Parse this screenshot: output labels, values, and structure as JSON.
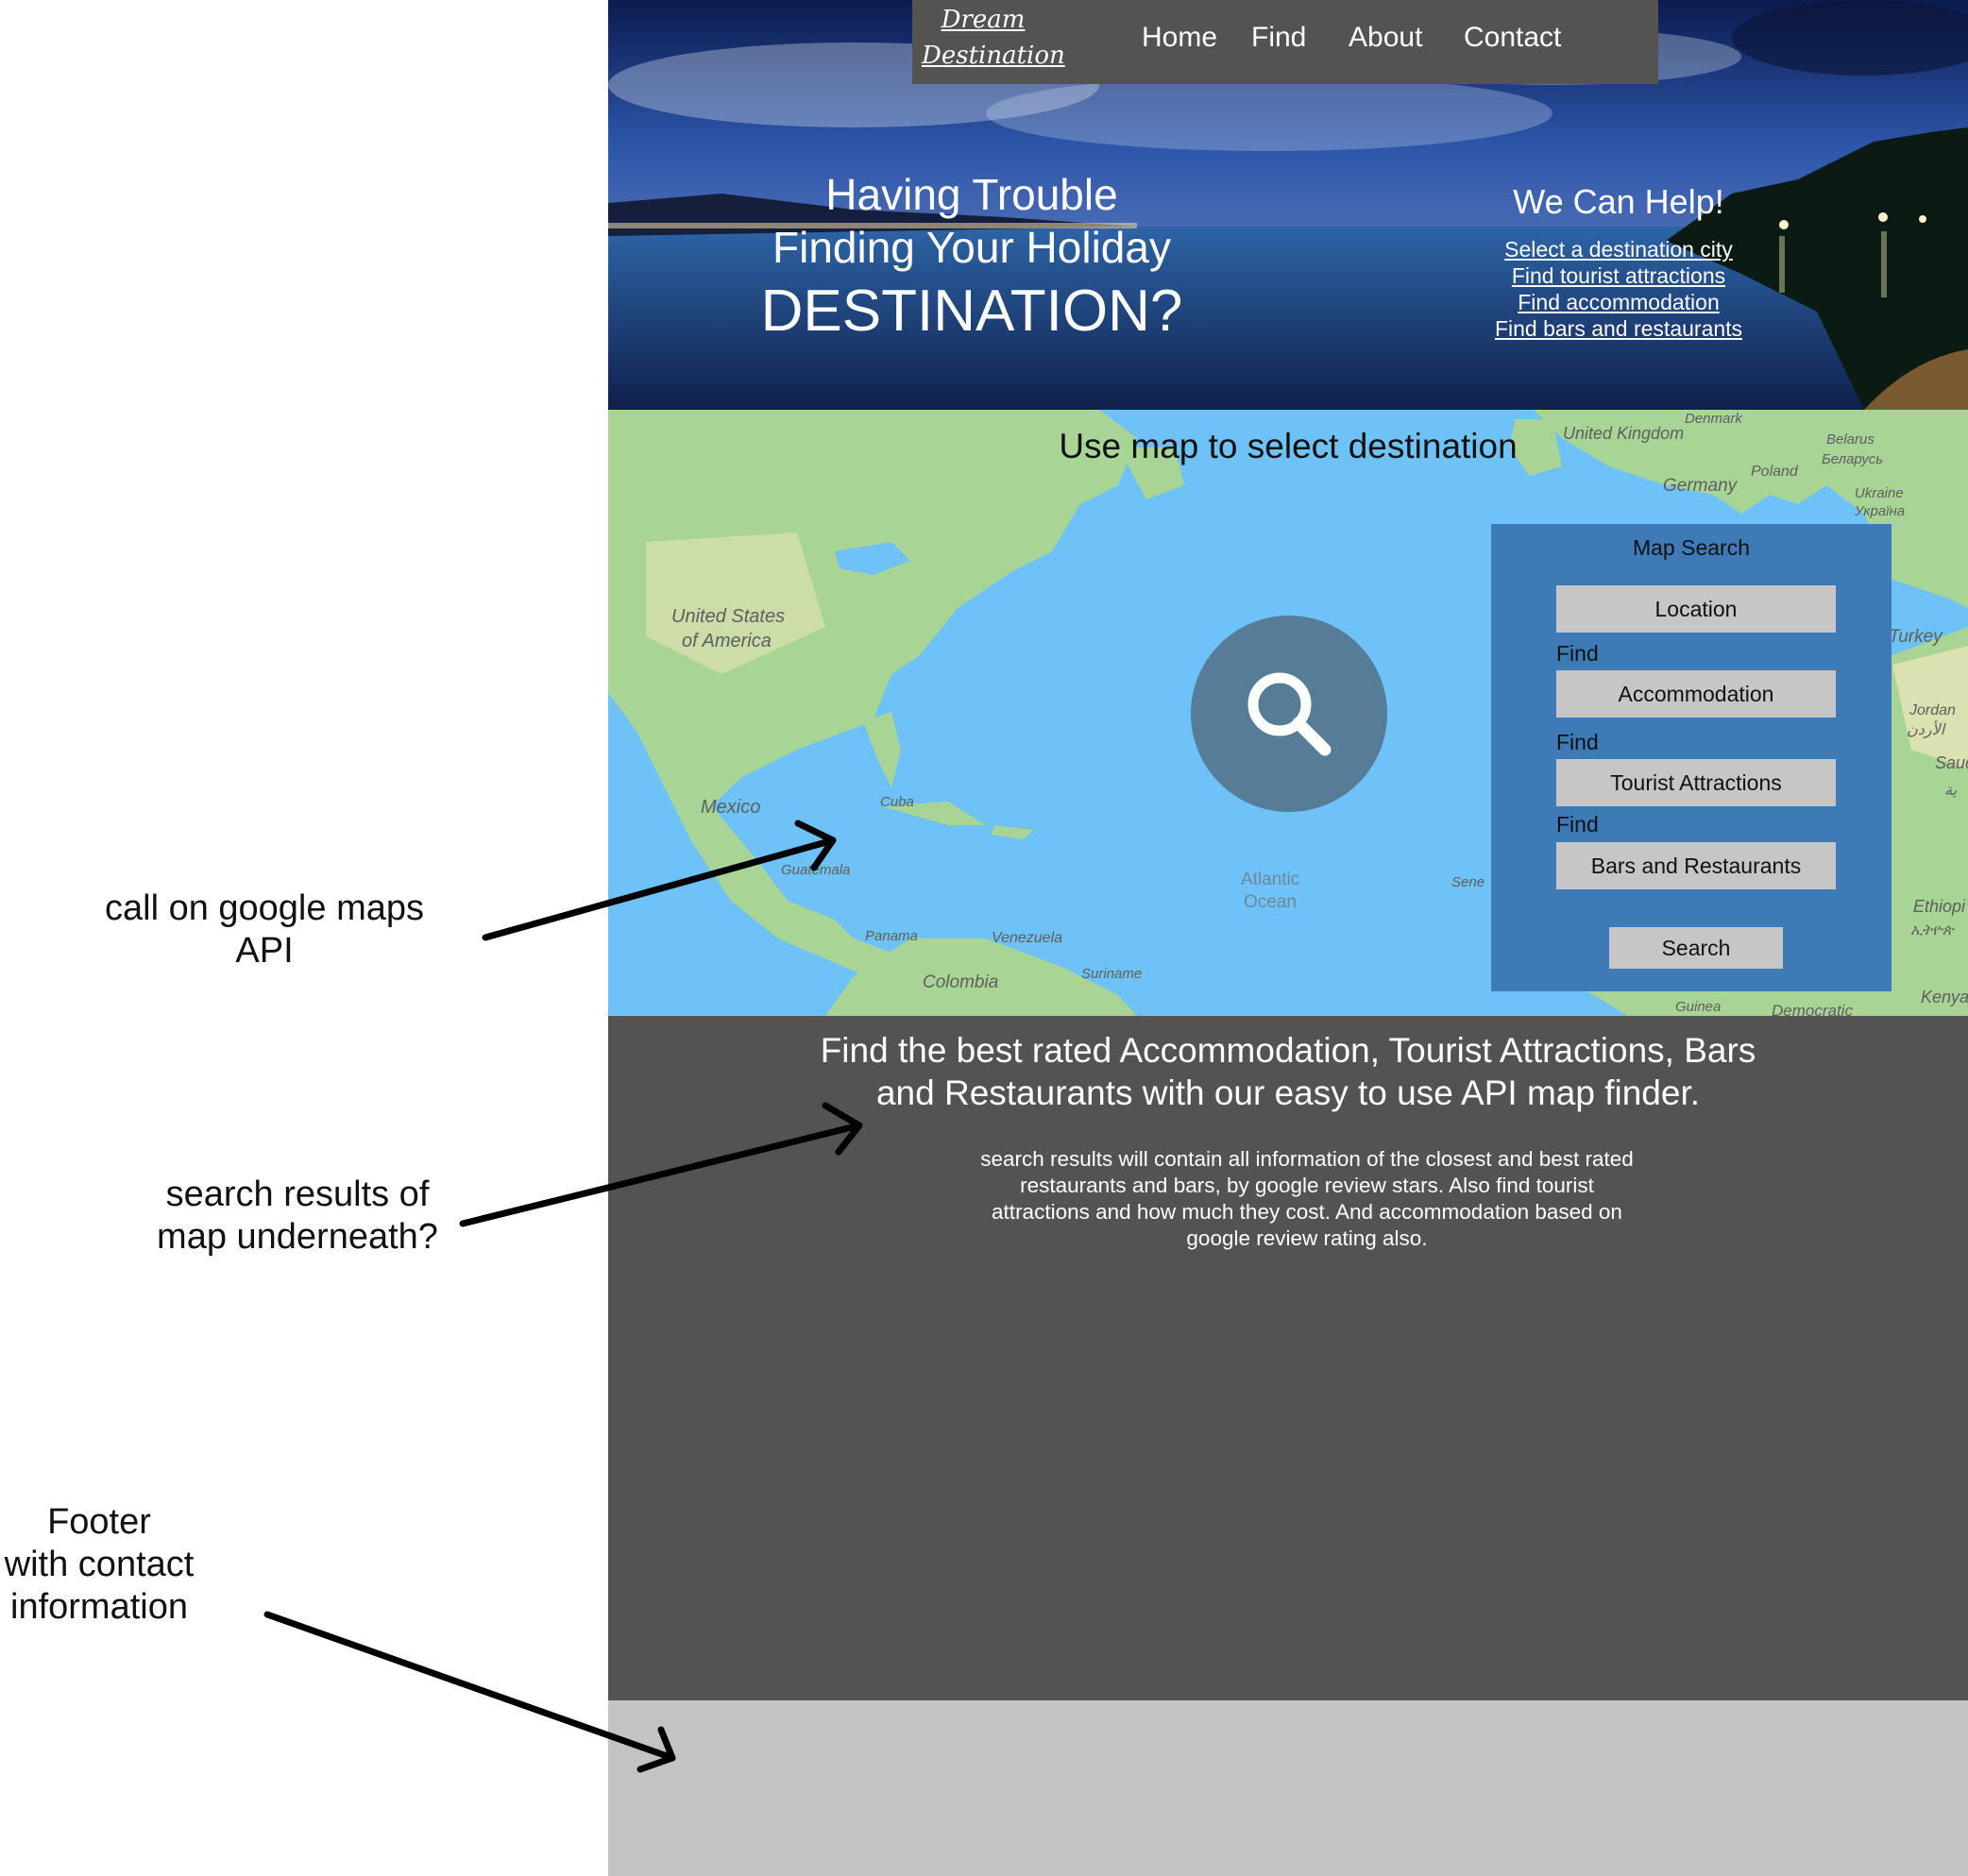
{
  "annotations": {
    "maps_api": [
      "call on google maps",
      "API"
    ],
    "search_results": [
      "search results of",
      "map underneath?"
    ],
    "footer": [
      "Footer",
      "with contact",
      "information"
    ]
  },
  "nav": {
    "logo_line1": "Dream",
    "logo_line2": "Destination",
    "items": [
      "Home",
      "Find",
      "About",
      "Contact"
    ]
  },
  "hero": {
    "line1": "Having Trouble",
    "line2": "Finding Your Holiday",
    "line3": "DESTINATION?",
    "help_title": "We Can Help!",
    "links": [
      "Select a destination city ",
      "Find tourist attractions ",
      "Find accommodation ",
      "Find bars and restaurants"
    ]
  },
  "map": {
    "title": "Use map to select destination",
    "labels": {
      "united_kingdom": "United Kingdom",
      "denmark": "Denmark",
      "belarus": "Belarus",
      "belarus_local": "Беларусь",
      "poland": "Poland",
      "germany": "Germany",
      "ukraine": "Ukraine",
      "ukraine_local": "Україна",
      "usa_1": "United States",
      "usa_2": "of America",
      "turkey": "Turkey",
      "jordan": "Jordan",
      "jordan_local": "الأردن",
      "saudi": "Saud",
      "saudi_local": "ية",
      "mexico": "Mexico",
      "cuba": "Cuba",
      "guatemala": "Guatemala",
      "atlantic_1": "Atlantic",
      "atlantic_2": "Ocean",
      "senegal": "Sene",
      "panama": "Panama",
      "venezuela": "Venezuela",
      "colombia": "Colombia",
      "suriname": "Suriname",
      "ethiopia": "Ethiopi",
      "ethiopia_local": "ኢትዮጵ",
      "kenya": "Kenya",
      "guinea": "Guinea",
      "democratic": "Democratic"
    }
  },
  "map_search": {
    "title": "Map Search",
    "location": "Location",
    "find_label": "Find",
    "accommodation": "Accommodation",
    "tourist": "Tourist Attractions",
    "bars": "Bars and Restaurants",
    "search_button": "Search"
  },
  "results": {
    "heading_line1": "Find the best rated Accommodation, Tourist Attractions, Bars",
    "heading_line2": "and Restaurants with our easy to use API map finder.",
    "desc": [
      "search results will contain all information of the closest and best rated",
      "restaurants and bars, by google review stars. Also find tourist",
      "attractions and how much they cost. And accommodation based on",
      "google review rating also."
    ]
  },
  "colors": {
    "nav_bg": "#545352",
    "map_water": "#6ec2f7",
    "map_land": "#a8d596",
    "map_search_bg": "#3d7ab6",
    "search_circle": "#567c98",
    "field_bg": "#c6c6c6",
    "results_bg": "#545352",
    "footer_bg": "#c3c3c3"
  }
}
